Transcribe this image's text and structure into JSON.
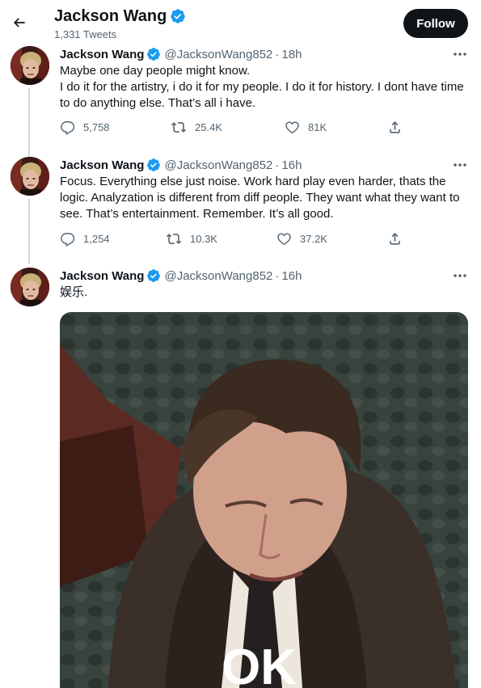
{
  "header": {
    "name": "Jackson Wang",
    "tweet_count": "1,331 Tweets",
    "follow_label": "Follow"
  },
  "tweets": [
    {
      "name": "Jackson Wang",
      "handle": "@JacksonWang852",
      "dot": "·",
      "time": "18h",
      "text": "Maybe one day people might know.\nI do it for the artistry, i do it for my people. I do it for history. I dont have time to do anything else. That’s all i have.",
      "replies": "5,758",
      "retweets": "25.4K",
      "likes": "81K"
    },
    {
      "name": "Jackson Wang",
      "handle": "@JacksonWang852",
      "dot": "·",
      "time": "16h",
      "text": "Focus. Everything else just noise. Work hard play even harder, thats the logic. Analyzation is different from diff people. They want what they want to see. That’s entertainment. Remember. It’s all good.",
      "replies": "1,254",
      "retweets": "10.3K",
      "likes": "37.2K"
    },
    {
      "name": "Jackson Wang",
      "handle": "@JacksonWang852",
      "dot": "·",
      "time": "16h",
      "text": "娱乐.",
      "media_caption": "OK"
    }
  ],
  "colors": {
    "verified": "#1d9bf0",
    "text_primary": "#0f1419",
    "text_secondary": "#536471",
    "follow_bg": "#0f1419"
  },
  "icons": {
    "back": "arrow-left-icon",
    "more": "more-dots-icon",
    "reply": "reply-icon",
    "retweet": "retweet-icon",
    "like": "heart-icon",
    "share": "share-icon",
    "verified": "verified-badge-icon"
  }
}
